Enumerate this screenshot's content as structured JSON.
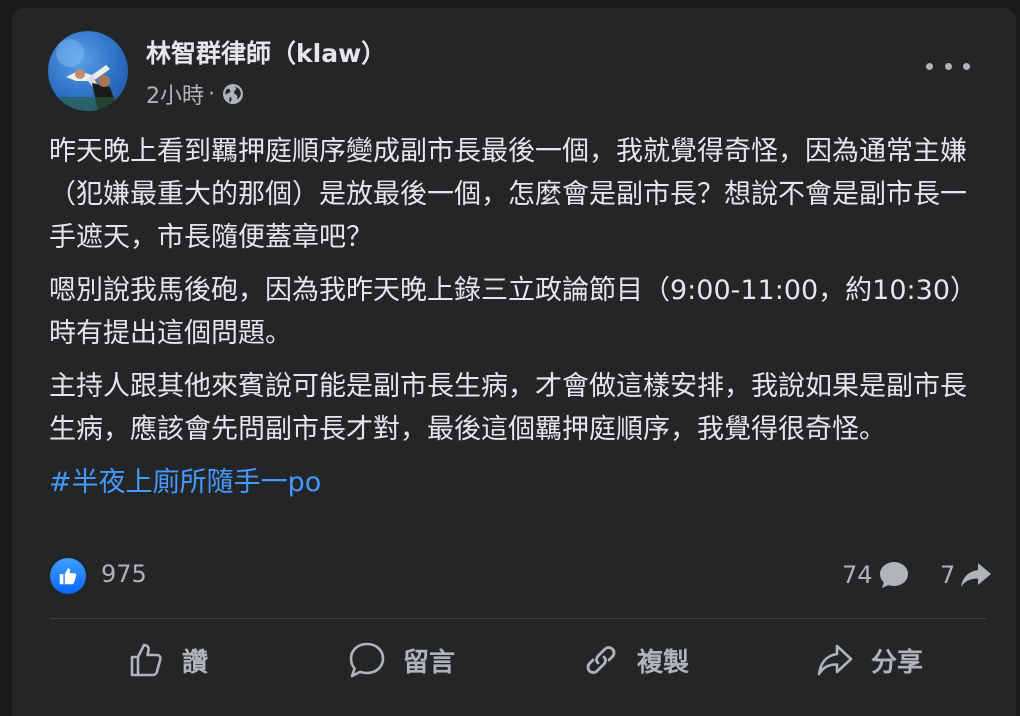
{
  "post": {
    "author": "林智群律師（klaw）",
    "time": "2小時",
    "separator": "·",
    "paragraphs": [
      "昨天晚上看到羈押庭順序變成副市長最後一個，我就覺得奇怪，因為通常主嫌（犯嫌最重大的那個）是放最後一個，怎麼會是副市長？想說不會是副市長一手遮天，市長隨便蓋章吧？",
      "嗯別說我馬後砲，因為我昨天晚上錄三立政論節目（9:00-11:00，約10:30）時有提出這個問題。",
      "主持人跟其他來賓說可能是副市長生病，才會做這樣安排，我說如果是副市長生病，應該會先問副市長才對，最後這個羈押庭順序，我覺得很奇怪。"
    ],
    "hashtag": "#半夜上廁所隨手一po"
  },
  "stats": {
    "likes": "975",
    "comments": "74",
    "shares": "7"
  },
  "actions": {
    "like": "讚",
    "comment": "留言",
    "copy": "複製",
    "share": "分享"
  },
  "icons": {
    "audience": "globe-icon",
    "menu": "more-horizontal-icon",
    "reaction": "thumbs-up-icon"
  },
  "colors": {
    "background": "#18191a",
    "card": "#242526",
    "text": "#e4e6eb",
    "secondary": "#b0b3b8",
    "link": "#4599ff",
    "like_blue": "#0866ff"
  }
}
